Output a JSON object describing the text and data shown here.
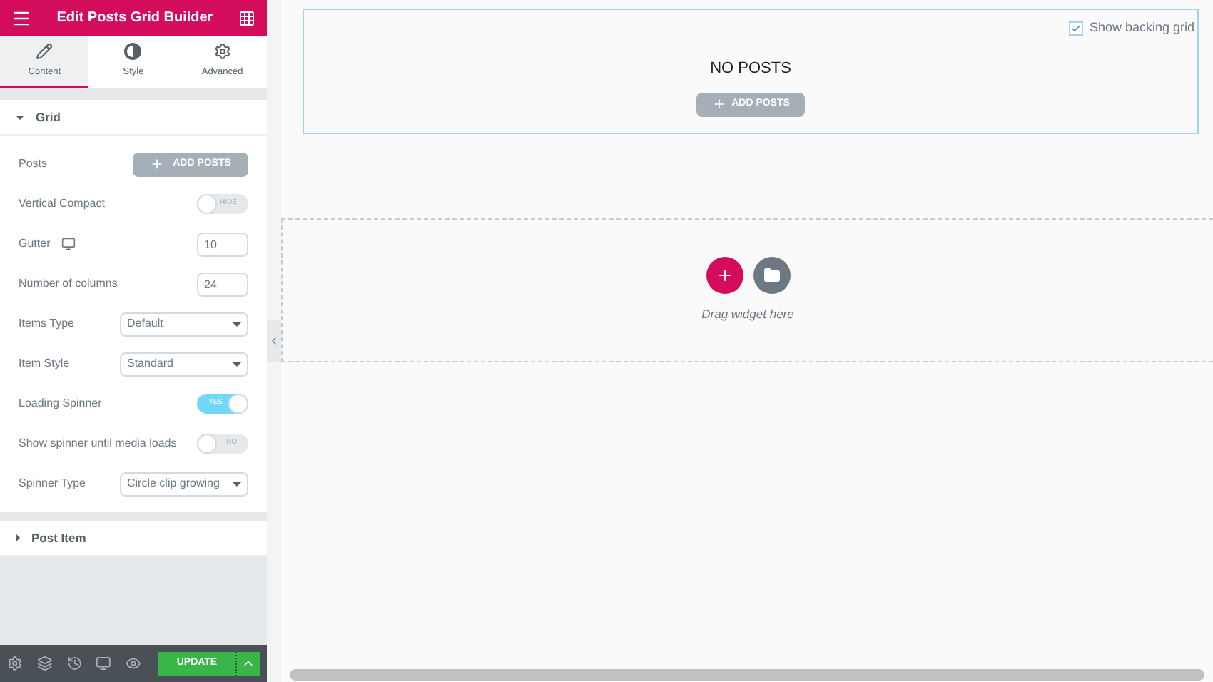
{
  "header": {
    "title": "Edit Posts Grid Builder"
  },
  "tabs": [
    {
      "label": "Content",
      "selected": true,
      "kind": "pencil"
    },
    {
      "label": "Style",
      "selected": false,
      "kind": "contrast"
    },
    {
      "label": "Advanced",
      "selected": false,
      "kind": "gear"
    }
  ],
  "sections": [
    {
      "title": "Grid",
      "expanded": true,
      "controls": [
        {
          "kind": "button",
          "label": "Posts",
          "value": "ADD POSTS"
        },
        {
          "kind": "switch",
          "label": "Vertical Compact",
          "on": false,
          "value": "HIDE"
        },
        {
          "kind": "number",
          "label": "Gutter",
          "responsive": true,
          "value": "10"
        },
        {
          "kind": "number",
          "label": "Number of columns",
          "value": "24"
        },
        {
          "kind": "select",
          "label": "Items Type",
          "value": "Default"
        },
        {
          "kind": "select",
          "label": "Item Style",
          "value": "Standard"
        },
        {
          "kind": "switch",
          "label": "Loading Spinner",
          "on": true,
          "value": "YES"
        },
        {
          "kind": "switch",
          "label": "Show spinner until media loads",
          "on": false,
          "value": "NO"
        },
        {
          "kind": "select",
          "label": "Spinner Type",
          "value": "Circle clip growing"
        }
      ]
    },
    {
      "title": "Post Item",
      "expanded": false
    }
  ],
  "footer": {
    "update": "UPDATE"
  },
  "canvas": {
    "backing_grid": {
      "label": "Show backing grid",
      "checked": true
    },
    "empty_title": "NO POSTS",
    "add_button": "ADD POSTS",
    "drop_hint": "Drag widget here"
  }
}
